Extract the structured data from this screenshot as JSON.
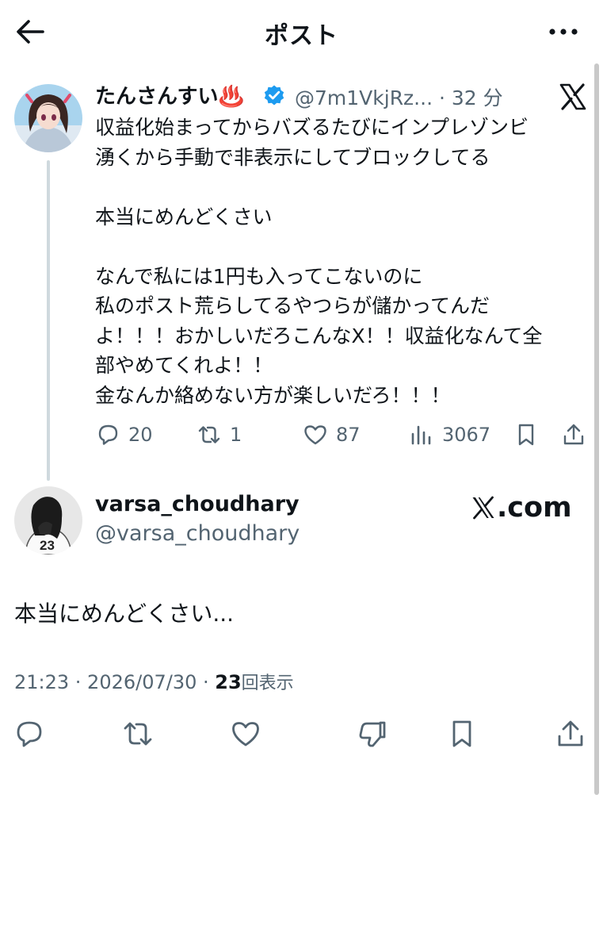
{
  "header": {
    "title": "ポスト",
    "back_icon": "arrow-left-icon",
    "more_icon": "more-horizontal-icon"
  },
  "parent_post": {
    "display_name": "たんさんすい♨️",
    "verified": true,
    "handle": "@7m1VkjRz... · 32 分",
    "text": "収益化始まってからバズるたびにインプレゾンビ\n湧くから手動で非表示にしてブロックしてる\n\n本当にめんどくさい\n\nなんで私には1円も入ってこないのに\n私のポスト荒らしてるやつらが儲かってんだ\nよ！！！おかしいだろこんなX！！収益化なんて全\n部やめてくれよ！！\n金なんか絡めない方が楽しいだろ！！！",
    "actions": {
      "replies": "20",
      "reposts": "1",
      "likes": "87",
      "views": "3067"
    }
  },
  "reply_post": {
    "display_name": "varsa_choudhary",
    "handle": "@varsa_choudhary",
    "watermark": ".com",
    "text": "本当にめんどくさい...",
    "timestamp": "21:23 · 2026/07/30 · ",
    "view_count": "23",
    "view_label": "回表示"
  },
  "colors": {
    "text": "#0f1419",
    "secondary": "#536471",
    "verified": "#1d9bf0",
    "thread_line": "#cfd9de"
  }
}
